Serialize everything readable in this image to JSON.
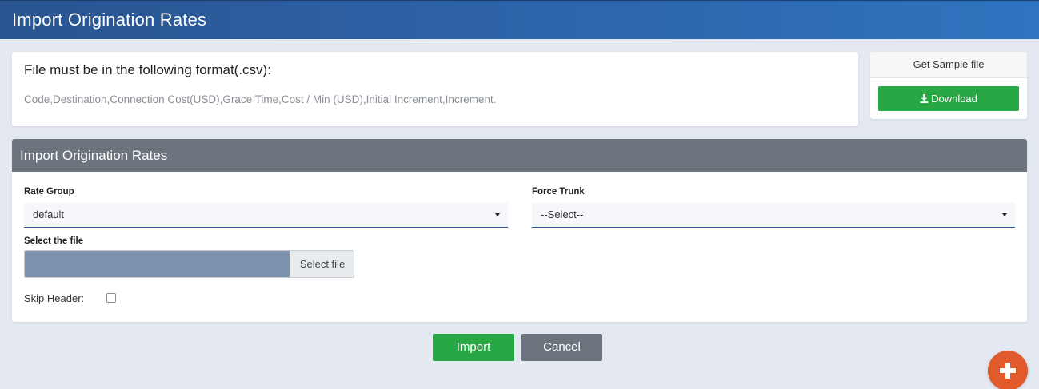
{
  "header": {
    "title": "Import Origination Rates"
  },
  "format_card": {
    "title": "File must be in the following format(.csv):",
    "description": "Code,Destination,Connection Cost(USD),Grace Time,Cost / Min (USD),Initial Increment,Increment."
  },
  "sample_card": {
    "title": "Get Sample file",
    "download_label": "Download"
  },
  "form": {
    "title": "Import Origination Rates",
    "rate_group": {
      "label": "Rate Group",
      "value": "default"
    },
    "force_trunk": {
      "label": "Force Trunk",
      "value": "--Select--"
    },
    "file": {
      "label": "Select the file",
      "button_label": "Select file"
    },
    "skip_header": {
      "label": "Skip Header:",
      "checked": false
    }
  },
  "actions": {
    "import_label": "Import",
    "cancel_label": "Cancel"
  },
  "colors": {
    "header_start": "#2a5591",
    "header_end": "#2f74bf",
    "success": "#28a745",
    "secondary": "#6c757d",
    "fab": "#e05a2b"
  },
  "icons": {
    "download": "download-icon",
    "select_caret": "chevron-down-icon",
    "fab": "plus-icon"
  }
}
